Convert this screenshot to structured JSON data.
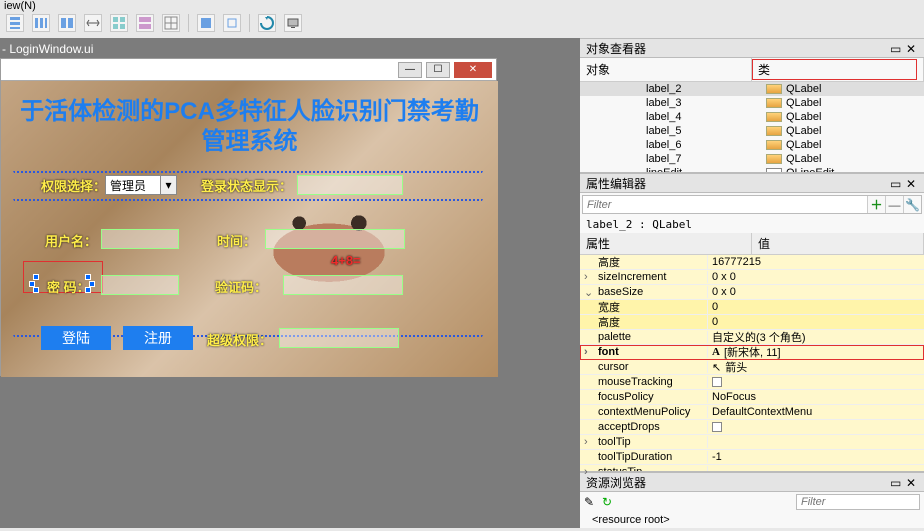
{
  "menu_remnant": "iew(N)",
  "toolbar_icons": [
    "layout-v",
    "layout-h",
    "layout-h2",
    "spacer",
    "layout-grid1",
    "layout-grid2",
    "layout-grid3",
    "sep",
    "stack1",
    "stack2",
    "sep",
    "recycle",
    "monitor"
  ],
  "designer": {
    "file_title": "- LoginWindow.ui"
  },
  "dialog": {
    "big_title_line1": "于活体检测的PCA多特征人脸识别门禁考勤",
    "big_title_line2": "管理系统",
    "perm_label": "权限选择：",
    "perm_value": "管理员",
    "status_label": "登录状态显示：",
    "user_label": "用户名：",
    "time_label": "时间：",
    "captcha_label": "4+8=",
    "pwd_label": "密  码：",
    "captcha2_label": "验证码：",
    "login_btn": "登陆",
    "register_btn": "注册",
    "super_label": "超级权限："
  },
  "object_viewer": {
    "title": "对象查看器",
    "col_object": "对象",
    "col_class": "类",
    "rows": [
      {
        "name": "label_2",
        "cls": "QLabel",
        "sel": true
      },
      {
        "name": "label_3",
        "cls": "QLabel"
      },
      {
        "name": "label_4",
        "cls": "QLabel"
      },
      {
        "name": "label_5",
        "cls": "QLabel"
      },
      {
        "name": "label_6",
        "cls": "QLabel"
      },
      {
        "name": "label_7",
        "cls": "QLabel"
      },
      {
        "name": "lineEdit",
        "cls": "QLineEdit"
      }
    ]
  },
  "prop_editor": {
    "title": "属性编辑器",
    "filter_placeholder": "Filter",
    "obj_line": "label_2 : QLabel",
    "col_prop": "属性",
    "col_val": "值",
    "rows": [
      {
        "name": "高度",
        "val": "16777215",
        "cls": "y"
      },
      {
        "name": "sizeIncrement",
        "val": "0 x 0",
        "cls": "y",
        "exp": ">"
      },
      {
        "name": "baseSize",
        "val": "0 x 0",
        "cls": "y",
        "exp": "v"
      },
      {
        "name": "宽度",
        "val": "0",
        "cls": "y2"
      },
      {
        "name": "高度",
        "val": "0",
        "cls": "y2"
      },
      {
        "name": "palette",
        "val": "自定义的(3 个角色)",
        "cls": "y"
      },
      {
        "name": "font",
        "val": "[新宋体, 11]",
        "cls": "y",
        "exp": ">",
        "hl": true,
        "font_icon": true
      },
      {
        "name": "cursor",
        "val": "箭头",
        "cls": "y",
        "cursor_icon": true
      },
      {
        "name": "mouseTracking",
        "val": "",
        "cls": "y",
        "check": true
      },
      {
        "name": "focusPolicy",
        "val": "NoFocus",
        "cls": "y"
      },
      {
        "name": "contextMenuPolicy",
        "val": "DefaultContextMenu",
        "cls": "y"
      },
      {
        "name": "acceptDrops",
        "val": "",
        "cls": "y",
        "check": true
      },
      {
        "name": "toolTip",
        "val": "",
        "cls": "y",
        "exp": ">"
      },
      {
        "name": "toolTipDuration",
        "val": "-1",
        "cls": "y"
      },
      {
        "name": "statusTip",
        "val": "",
        "cls": "y",
        "exp": ">"
      }
    ]
  },
  "res_browser": {
    "title": "资源浏览器",
    "filter_placeholder": "Filter",
    "root": "<resource root>"
  }
}
